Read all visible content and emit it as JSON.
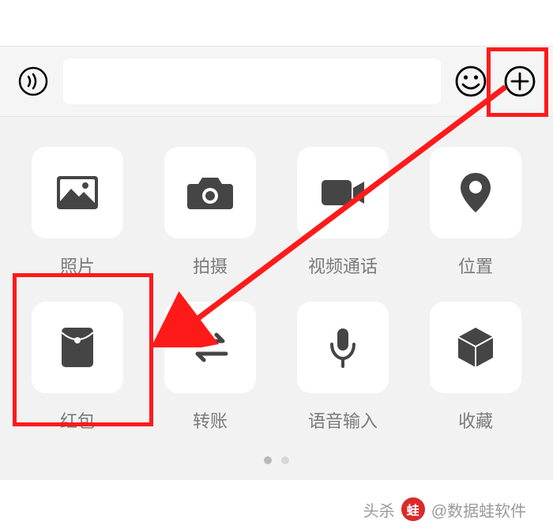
{
  "inputBar": {
    "placeholder": ""
  },
  "grid": {
    "items": [
      {
        "id": "photo",
        "label": "照片"
      },
      {
        "id": "camera",
        "label": "拍摄"
      },
      {
        "id": "video-call",
        "label": "视频通话"
      },
      {
        "id": "location",
        "label": "位置"
      },
      {
        "id": "red-packet",
        "label": "红包"
      },
      {
        "id": "transfer",
        "label": "转账"
      },
      {
        "id": "voice-input",
        "label": "语音输入"
      },
      {
        "id": "favorites",
        "label": "收藏"
      }
    ]
  },
  "watermark": {
    "prefix": "头杀",
    "handle": "@数据蛙软件"
  },
  "annotation": {
    "arrowColor": "#ff1a1a",
    "highlightColor": "#ff1a1a"
  }
}
